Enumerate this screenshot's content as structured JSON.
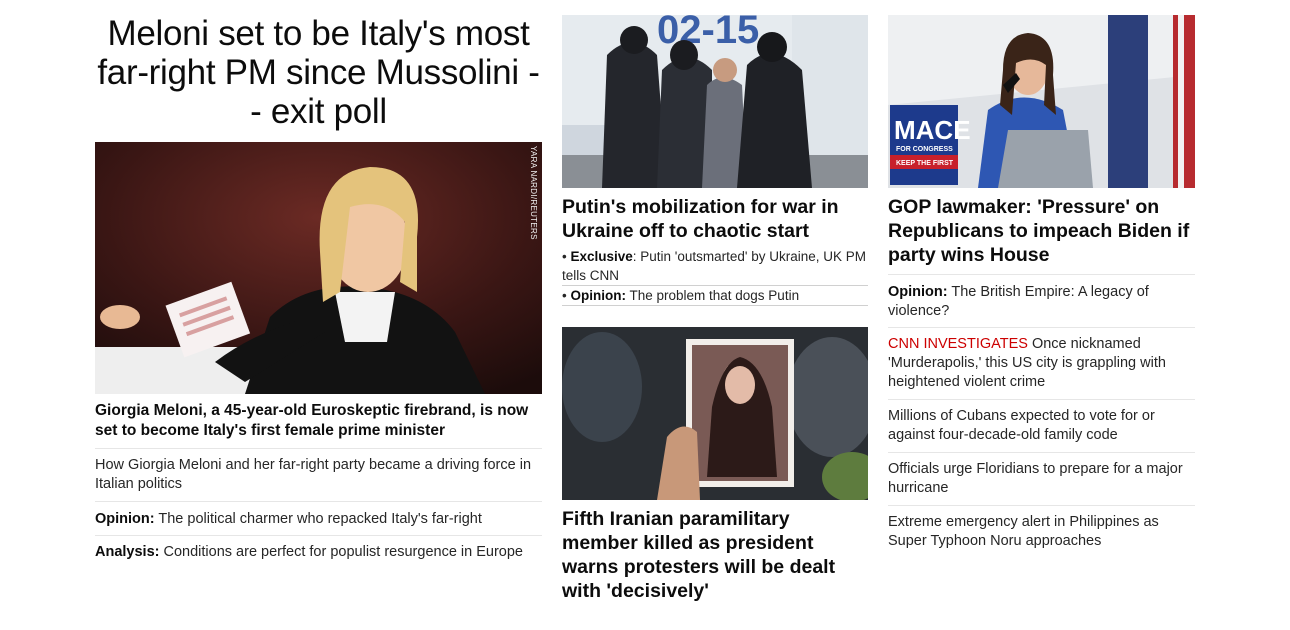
{
  "lead": {
    "headline": "Meloni set to be Italy's most far-right PM since Mussolini -- exit poll",
    "photo_credit": "YARA NARDI/REUTERS",
    "caption": "Giorgia Meloni, a 45-year-old Euroskeptic firebrand, is now set to become Italy's first female prime minister",
    "related": [
      {
        "prefix": "",
        "text": "How Giorgia Meloni and her far-right party became a driving force in Italian politics"
      },
      {
        "prefix": "Opinion:",
        "text": " The political charmer who repacked Italy's far-right"
      },
      {
        "prefix": "Analysis:",
        "text": " Conditions are perfect for populist resurgence in Europe"
      }
    ]
  },
  "col2": {
    "story1": {
      "headline": "Putin's mobilization for war in Ukraine off to chaotic start",
      "sublinks": [
        {
          "bullet": "• ",
          "prefix": "Exclusive",
          "text": ": Putin 'outsmarted' by Ukraine, UK PM tells CNN"
        },
        {
          "bullet": "• ",
          "prefix": "Opinion:",
          "text": " The problem that dogs Putin"
        }
      ]
    },
    "story2": {
      "headline": "Fifth Iranian paramilitary member killed as president warns protesters will be dealt with 'decisively'"
    }
  },
  "col3": {
    "story1": {
      "headline": "GOP lawmaker: 'Pressure' on Republicans to impeach Biden if party wins House",
      "sign_text": "MACE",
      "sign_sub": "FOR CONGRESS",
      "sign_band": "KEEP THE FIRST"
    },
    "links": [
      {
        "prefix": "Opinion:",
        "label": "",
        "text": " The British Empire: A legacy of violence?"
      },
      {
        "prefix": "",
        "label": "CNN INVESTIGATES",
        "text": " Once nicknamed 'Murderapolis,' this US city is grappling with heightened violent crime"
      },
      {
        "prefix": "",
        "label": "",
        "text": "Millions of Cubans expected to vote for or against four-decade-old family code"
      },
      {
        "prefix": "",
        "label": "",
        "text": "Officials urge Floridians to prepare for a major hurricane"
      },
      {
        "prefix": "",
        "label": "",
        "text": "Extreme emergency alert in Philippines as Super Typhoon Noru approaches"
      }
    ]
  },
  "colors": {
    "text": "#0c0c0c",
    "investigates_red": "#cc0000",
    "divider": "#e6e6e6"
  }
}
